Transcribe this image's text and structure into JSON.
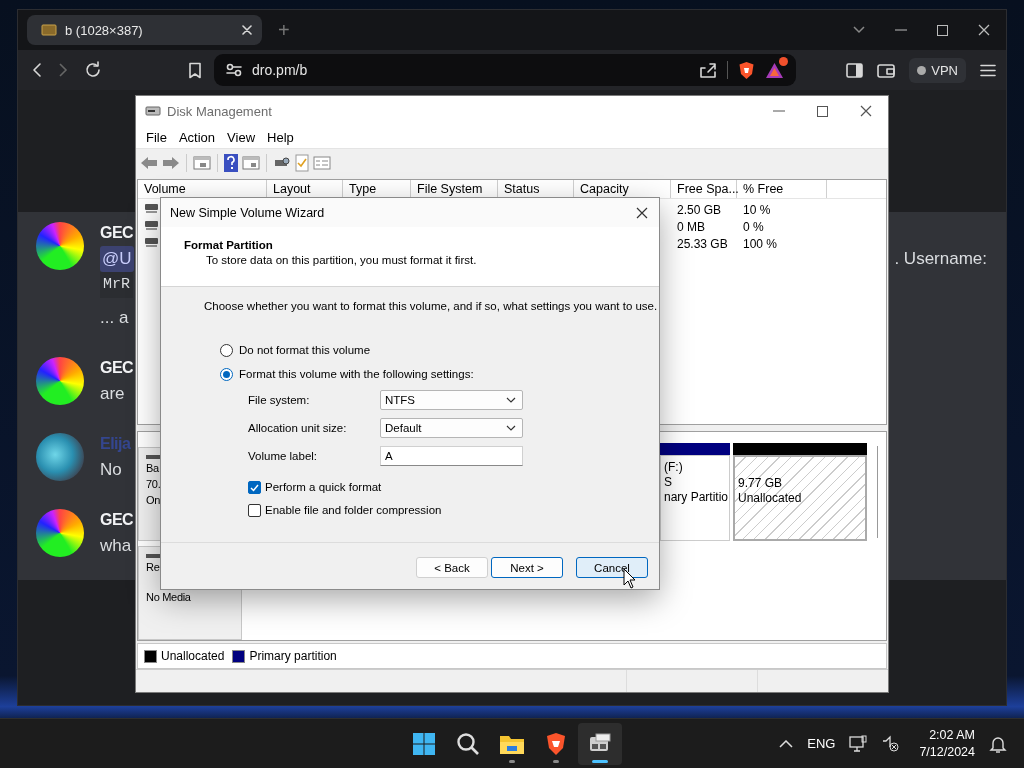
{
  "browser": {
    "tab": {
      "title": "b (1028×387)",
      "selected": true
    },
    "new_tab": "+",
    "url": "dro.pm/b",
    "vpn": "VPN"
  },
  "chat": {
    "messages": [
      {
        "author": "GEC",
        "color": "#f2f3f5",
        "kind": "rainbow",
        "lines": [
          {
            "kind": "mention",
            "text": "@U",
            "trailing": ". Username:"
          },
          {
            "kind": "code",
            "text": "MrR"
          },
          {
            "kind": "text",
            "text": "... a"
          }
        ]
      },
      {
        "author": "GEC",
        "color": "#f2f3f5",
        "kind": "rainbow",
        "lines": [
          {
            "kind": "text",
            "text": "are"
          }
        ]
      },
      {
        "author": "Elija",
        "color": "#34468f",
        "kind": "cartoon",
        "lines": [
          {
            "kind": "text",
            "text": "No"
          }
        ]
      },
      {
        "author": "GEC",
        "color": "#f2f3f5",
        "kind": "rainbow",
        "lines": [
          {
            "kind": "text",
            "text": "wha"
          }
        ]
      }
    ]
  },
  "disk_management": {
    "title": "Disk Management",
    "menu": [
      "File",
      "Action",
      "View",
      "Help"
    ],
    "columns": [
      "Volume",
      "Layout",
      "Type",
      "File System",
      "Status",
      "Capacity",
      "Free Spa...",
      "% Free"
    ],
    "rows": [
      {
        "free_space": "2.50 GB",
        "percent_free": "10 %"
      },
      {
        "free_space": "0 MB",
        "percent_free": "0 %"
      },
      {
        "free_space": "25.33 GB",
        "percent_free": "100 %"
      }
    ],
    "disks": [
      {
        "labels": [
          "Ba",
          "70.",
          "On"
        ],
        "partitions": [
          {
            "kind": "primary",
            "lines": [
              "(F:)",
              "S",
              "nary Partitio"
            ]
          },
          {
            "kind": "unallocated",
            "lines": [
              "9.77 GB",
              "Unallocated"
            ]
          }
        ]
      },
      {
        "labels": [
          "Re",
          "No Media"
        ]
      }
    ],
    "legend": [
      {
        "label": "Unallocated",
        "color": "#000000"
      },
      {
        "label": "Primary partition",
        "color": "#00007f"
      }
    ]
  },
  "wizard": {
    "title": "New Simple Volume Wizard",
    "heading": "Format Partition",
    "subheading": "To store data on this partition, you must format it first.",
    "instruction": "Choose whether you want to format this volume, and if so, what settings you want to use.",
    "options": [
      {
        "label": "Do not format this volume",
        "selected": false
      },
      {
        "label": "Format this volume with the following settings:",
        "selected": true
      }
    ],
    "settings": [
      {
        "label": "File system:",
        "value": "NTFS",
        "kind": "dropdown"
      },
      {
        "label": "Allocation unit size:",
        "value": "Default",
        "kind": "dropdown"
      },
      {
        "label": "Volume label:",
        "value": "A",
        "kind": "text"
      }
    ],
    "checkboxes": [
      {
        "label": "Perform a quick format",
        "checked": true
      },
      {
        "label": "Enable file and folder compression",
        "checked": false
      }
    ],
    "buttons": [
      {
        "label": "< Back",
        "kind": "normal"
      },
      {
        "label": "Next >",
        "kind": "default"
      },
      {
        "label": "Cancel",
        "kind": "hover"
      }
    ]
  },
  "taskbar": {
    "apps": [
      {
        "kind": "start",
        "running": false,
        "active": false
      },
      {
        "kind": "search",
        "running": false,
        "active": false
      },
      {
        "kind": "folder",
        "running": true,
        "active": false
      },
      {
        "kind": "shield",
        "running": true,
        "active": false
      },
      {
        "kind": "drive",
        "running": true,
        "active": true
      }
    ],
    "language": "ENG",
    "time": "2:02 AM",
    "date": "7/12/2024"
  }
}
